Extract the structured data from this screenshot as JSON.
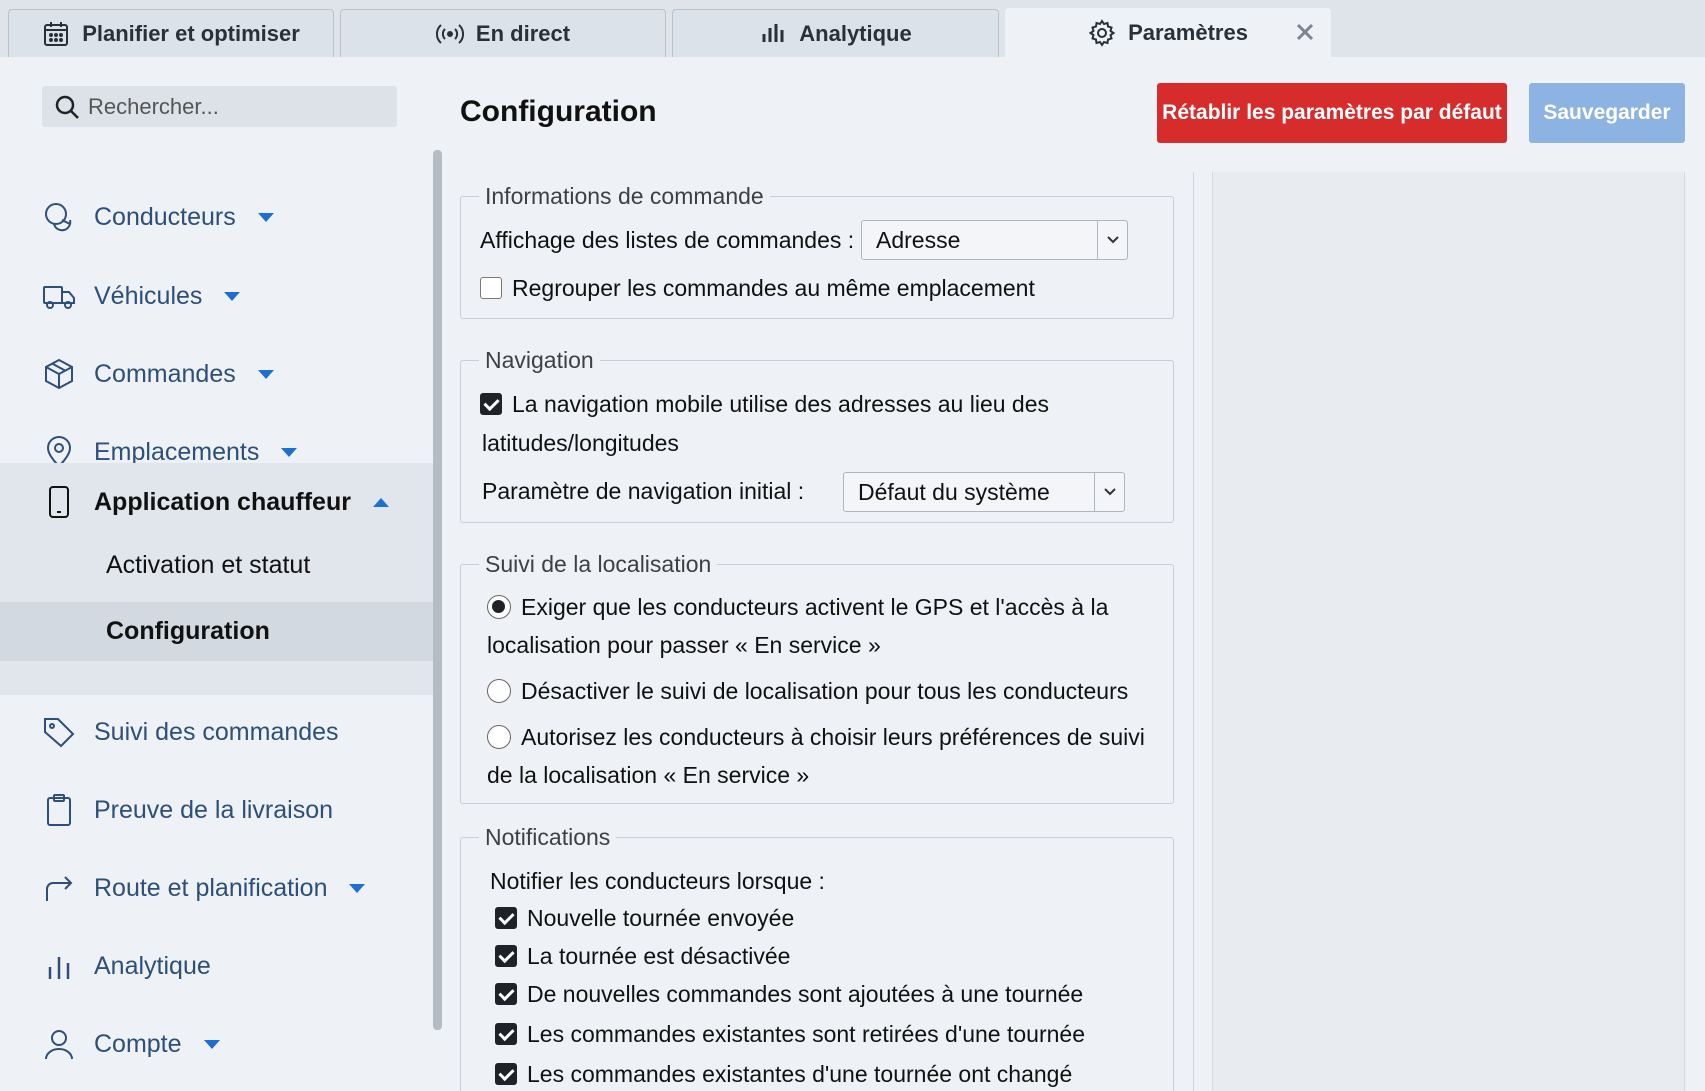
{
  "tabs": [
    {
      "label": "Planifier et optimiser",
      "icon": "calendar-icon"
    },
    {
      "label": "En direct",
      "icon": "broadcast-icon"
    },
    {
      "label": "Analytique",
      "icon": "bar-chart-icon"
    },
    {
      "label": "Paramètres",
      "icon": "gear-icon",
      "active": true
    }
  ],
  "search": {
    "placeholder": "Rechercher..."
  },
  "sidebar": {
    "items": [
      {
        "label": "Conducteurs",
        "icon": "drivers-icon",
        "caret": "down"
      },
      {
        "label": "Véhicules",
        "icon": "truck-icon",
        "caret": "down"
      },
      {
        "label": "Commandes",
        "icon": "package-icon",
        "caret": "down"
      },
      {
        "label": "Emplacements",
        "icon": "location-pin-icon",
        "caret": "down"
      },
      {
        "label": "Application chauffeur",
        "icon": "phone-icon",
        "caret": "up"
      },
      {
        "label": "Suivi des commandes",
        "icon": "tag-icon"
      },
      {
        "label": "Preuve de la livraison",
        "icon": "clipboard-icon"
      },
      {
        "label": "Route et planification",
        "icon": "route-arrow-icon",
        "caret": "down"
      },
      {
        "label": "Analytique",
        "icon": "bar-chart-icon"
      },
      {
        "label": "Compte",
        "icon": "user-icon",
        "caret": "down"
      }
    ],
    "sub_items": [
      {
        "label": "Activation et statut"
      },
      {
        "label": "Configuration",
        "selected": true
      }
    ]
  },
  "main": {
    "title": "Configuration",
    "reset_label": "Rétablir les paramètres par défaut",
    "save_label": "Sauvegarder",
    "colors": {
      "reset": "#d62c2c",
      "save": "#8db3e3",
      "accent": "#1f6fd1"
    }
  },
  "sections": {
    "orders": {
      "legend": "Informations de commande",
      "display_label": "Affichage des listes de commandes :",
      "display_value": "Adresse",
      "group_label": "Regrouper les commandes au même emplacement",
      "group_checked": false
    },
    "navigation": {
      "legend": "Navigation",
      "mobile_line1": "La navigation mobile utilise des adresses au lieu des",
      "mobile_line2": "latitudes/longitudes",
      "mobile_checked": true,
      "initial_label": "Paramètre de navigation initial :",
      "initial_value": "Défaut du système"
    },
    "tracking": {
      "legend": "Suivi de la localisation",
      "opt1_line1": "Exiger que les conducteurs activent le GPS et l'accès à la",
      "opt1_line2": "localisation pour passer « En service »",
      "opt2": "Désactiver le suivi de localisation pour tous les conducteurs",
      "opt3_line1": "Autorisez les conducteurs à choisir leurs préférences de suivi",
      "opt3_line2": "de la localisation « En service »",
      "selected": 1
    },
    "notifications": {
      "legend": "Notifications",
      "intro": "Notifier les conducteurs lorsque :",
      "items": [
        {
          "label": "Nouvelle tournée envoyée",
          "checked": true
        },
        {
          "label": "La tournée est désactivée",
          "checked": true
        },
        {
          "label": "De nouvelles commandes sont ajoutées à une tournée",
          "checked": true
        },
        {
          "label": "Les commandes existantes sont retirées d'une tournée",
          "checked": true
        },
        {
          "label": "Les commandes existantes d'une tournée ont changé",
          "checked": true
        }
      ]
    }
  }
}
